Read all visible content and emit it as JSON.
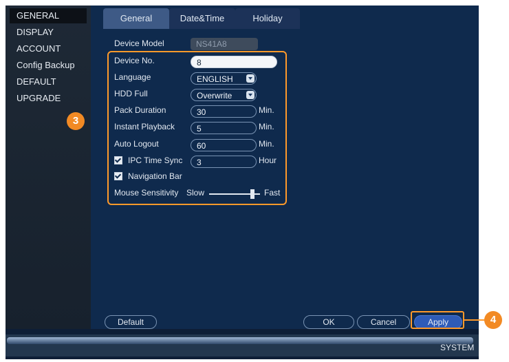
{
  "sidebar": {
    "items": [
      {
        "label": "GENERAL",
        "active": true
      },
      {
        "label": "DISPLAY"
      },
      {
        "label": "ACCOUNT"
      },
      {
        "label": "Config Backup"
      },
      {
        "label": "DEFAULT"
      },
      {
        "label": "UPGRADE"
      }
    ]
  },
  "tabs": [
    {
      "label": "General",
      "active": true
    },
    {
      "label": "Date&Time"
    },
    {
      "label": "Holiday"
    }
  ],
  "form": {
    "device_model_label": "Device Model",
    "device_model_value": "NS41A8",
    "device_no_label": "Device No.",
    "device_no_value": "8",
    "language_label": "Language",
    "language_value": "ENGLISH",
    "hdd_full_label": "HDD Full",
    "hdd_full_value": "Overwrite",
    "pack_duration_label": "Pack Duration",
    "pack_duration_value": "30",
    "pack_duration_unit": "Min.",
    "instant_playback_label": "Instant Playback",
    "instant_playback_value": "5",
    "instant_playback_unit": "Min.",
    "auto_logout_label": "Auto Logout",
    "auto_logout_value": "60",
    "auto_logout_unit": "Min.",
    "ipc_time_sync_label": "IPC Time Sync",
    "ipc_time_sync_checked": true,
    "ipc_time_sync_value": "3",
    "ipc_time_sync_unit": "Hour",
    "navigation_bar_label": "Navigation Bar",
    "navigation_bar_checked": true,
    "mouse_sensitivity_label": "Mouse Sensitivity",
    "mouse_sensitivity_slow": "Slow",
    "mouse_sensitivity_fast": "Fast",
    "mouse_sensitivity_level": 0.85
  },
  "buttons": {
    "default": "Default",
    "ok": "OK",
    "cancel": "Cancel",
    "apply": "Apply"
  },
  "callouts": {
    "form_marker": "3",
    "apply_marker": "4"
  },
  "footer": {
    "label": "SYSTEM"
  },
  "colors": {
    "accent_orange": "#f28a24",
    "panel_blue": "#0f2a4d",
    "sidebar_bg": "#1e2936",
    "primary_button": "#2e5bb7"
  }
}
